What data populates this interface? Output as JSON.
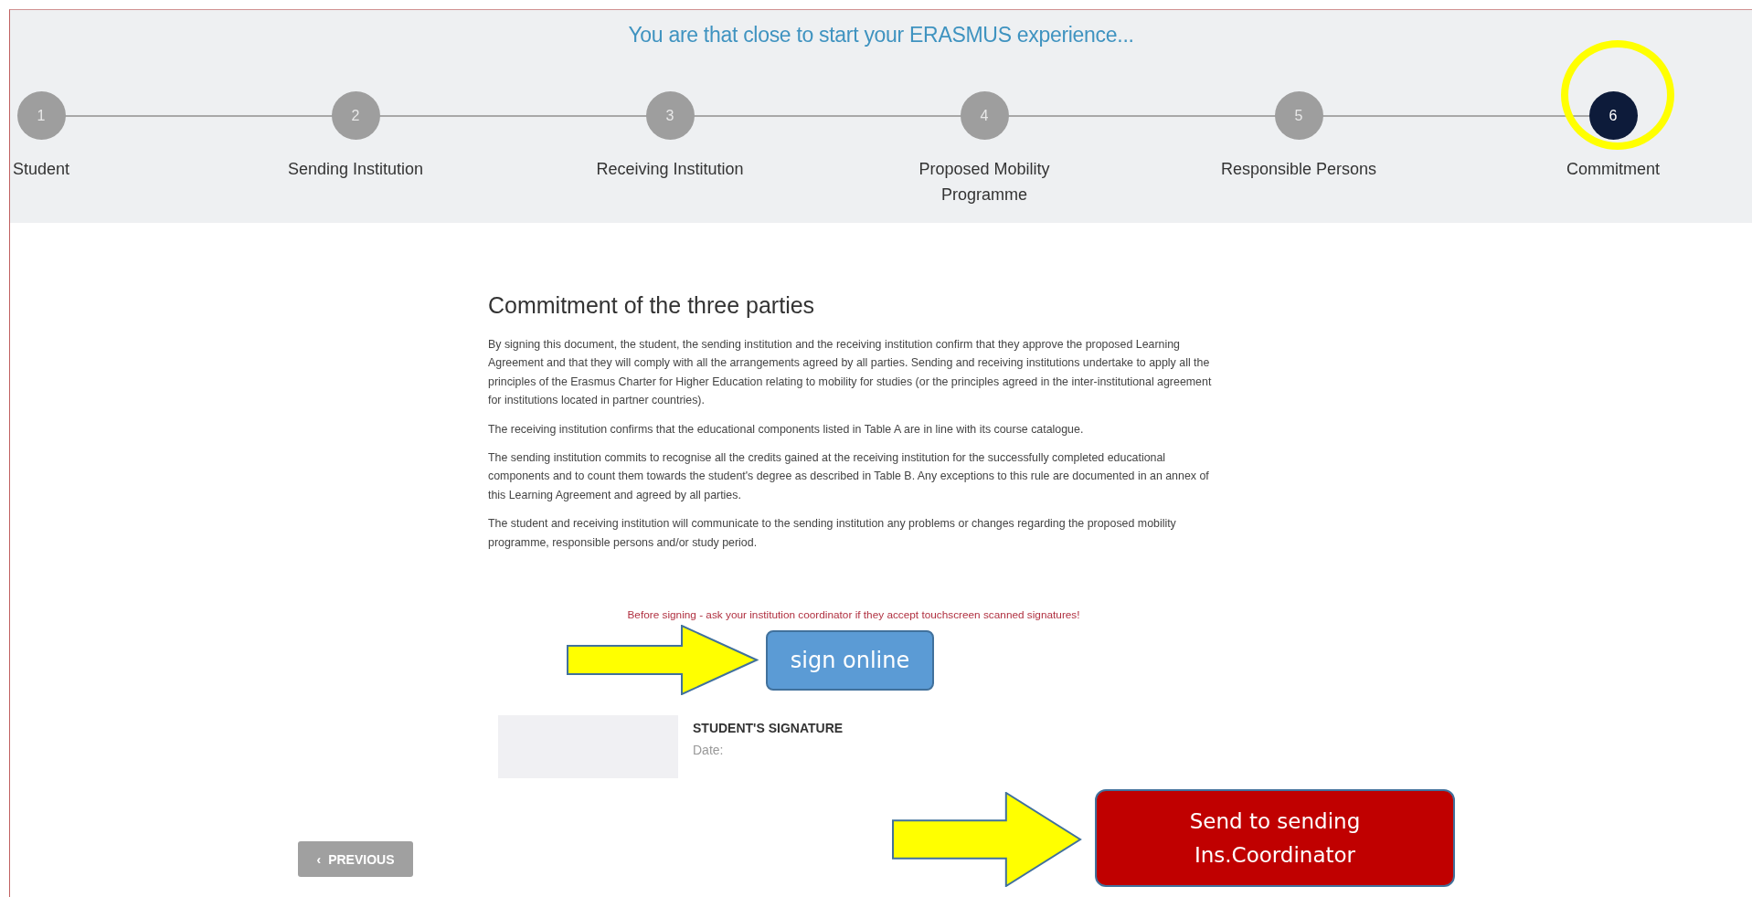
{
  "title": "You are that close to start your ERASMUS experience...",
  "steps": [
    {
      "number": "1",
      "label": "Student",
      "selected": false,
      "highlighted": false
    },
    {
      "number": "2",
      "label": "Sending Institution",
      "selected": false,
      "highlighted": false
    },
    {
      "number": "3",
      "label": "Receiving Institution",
      "selected": false,
      "highlighted": false
    },
    {
      "number": "4",
      "label": "Proposed Mobility Programme",
      "selected": false,
      "highlighted": false
    },
    {
      "number": "5",
      "label": "Responsible Persons",
      "selected": false,
      "highlighted": false
    },
    {
      "number": "6",
      "label": "Commitment",
      "selected": true,
      "highlighted": true
    }
  ],
  "heading": "Commitment of the three parties",
  "paragraphs": [
    "By signing this document, the student, the sending institution and the receiving institution confirm that they approve the proposed Learning Agreement and that they will comply with all the arrangements agreed by all parties. Sending and receiving institutions undertake to apply all the principles of the Erasmus Charter for Higher Education relating to mobility for studies (or the principles agreed in the inter-institutional agreement for institutions located in partner countries).",
    "The receiving institution confirms that the educational components listed in Table A are in line with its course catalogue.",
    "The sending institution commits to recognise all the credits gained at the receiving institution for the successfully completed educational components and to count them towards the student's degree as described in Table B. Any exceptions to this rule are documented in an annex of this Learning Agreement and agreed by all parties.",
    "The student and receiving institution will communicate to the sending institution any problems or changes regarding the proposed mobility programme, responsible persons and/or study period."
  ],
  "notice": "Before signing - ask your institution coordinator if they accept touchscreen scanned signatures!",
  "sign_button": {
    "label": "sign online",
    "annotated": true
  },
  "signature": {
    "title": "STUDENT'S SIGNATURE",
    "date_label": "Date:"
  },
  "previous_button": {
    "icon": "‹",
    "label": "PREVIOUS"
  },
  "send_button": {
    "label": "Send to sending Ins.Coordinator",
    "annotated": true
  }
}
